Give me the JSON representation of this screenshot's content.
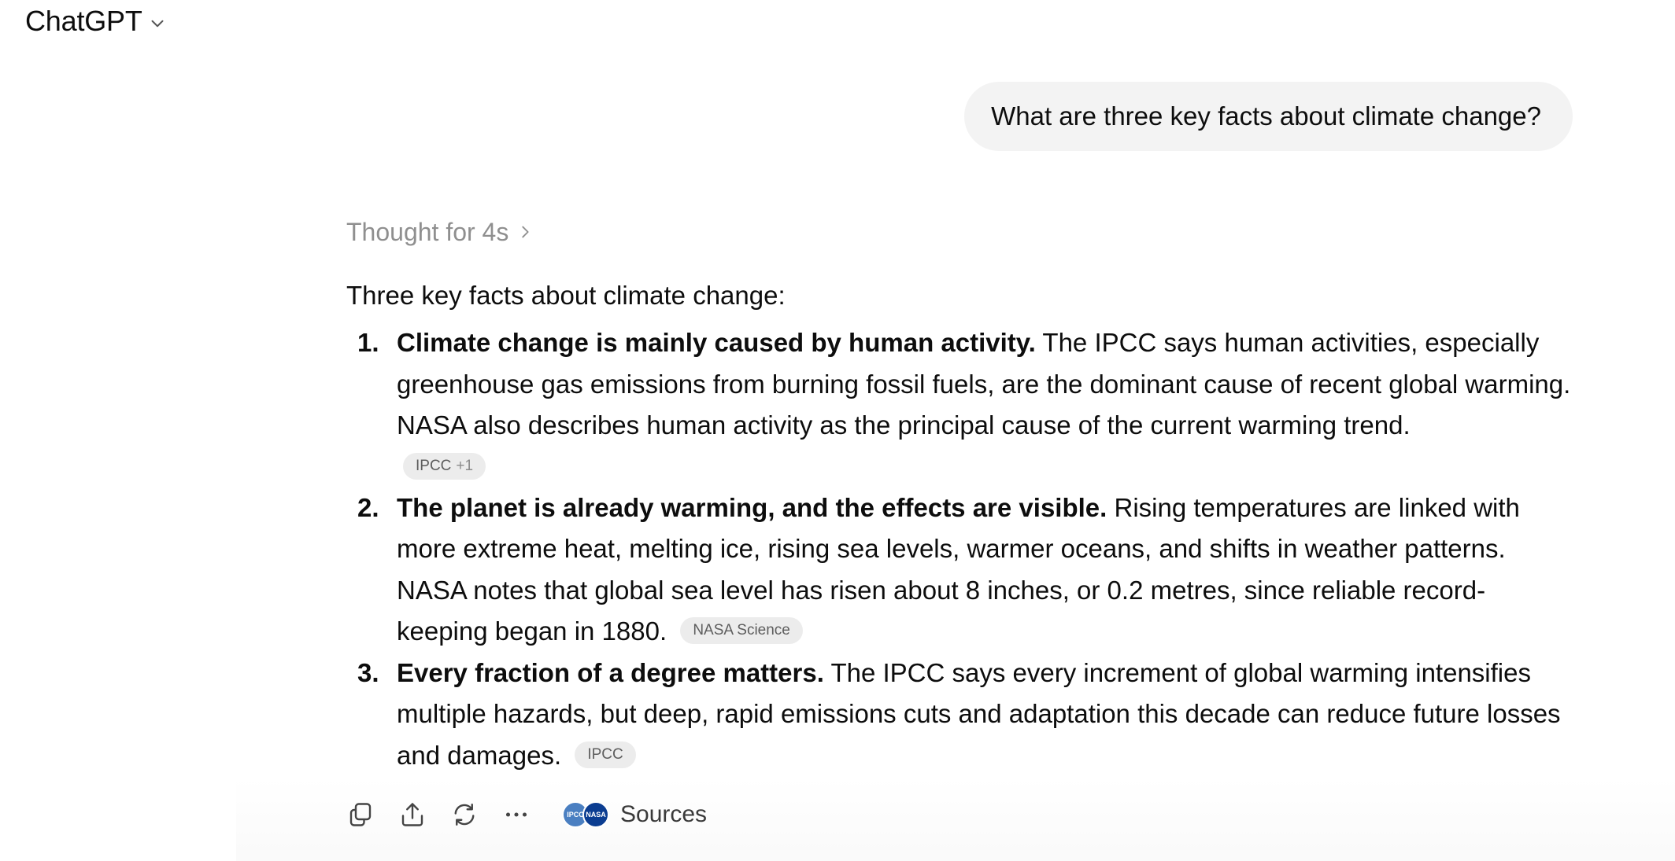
{
  "header": {
    "title": "ChatGPT"
  },
  "user_message": "What are three key facts about climate change?",
  "assistant": {
    "thought_label": "Thought for 4s",
    "intro": "Three key facts about climate change:",
    "facts": [
      {
        "number": "1.",
        "lead": "Climate change is mainly caused by human activity.",
        "body": " The IPCC says human activities, especially greenhouse gas emissions from burning fossil fuels, are the dominant cause of recent global warming. NASA also describes human activity as the principal cause of the current warming trend.",
        "citation": "IPCC",
        "citation_extra": "+1"
      },
      {
        "number": "2.",
        "lead": "The planet is already warming, and the effects are visible.",
        "body": " Rising temperatures are linked with more extreme heat, melting ice, rising sea levels, warmer oceans, and shifts in weather patterns. NASA notes that global sea level has risen about 8 inches, or 0.2 metres, since reliable record-keeping began in 1880.",
        "citation": "NASA Science"
      },
      {
        "number": "3.",
        "lead": "Every fraction of a degree matters.",
        "body": " The IPCC says every increment of global warming intensifies multiple hazards, but deep, rapid emissions cuts and adaptation this decade can reduce future losses and damages.",
        "citation": "IPCC"
      }
    ]
  },
  "actions": {
    "icons": [
      "copy-icon",
      "share-icon",
      "regenerate-icon",
      "more-icon"
    ],
    "sources_label": "Sources",
    "source_favicons": [
      "IPCC",
      "NASA"
    ]
  },
  "colors": {
    "bubble_bg": "#f3f3f3",
    "pill_bg": "#ececec",
    "muted_text": "#8f8f8f"
  }
}
